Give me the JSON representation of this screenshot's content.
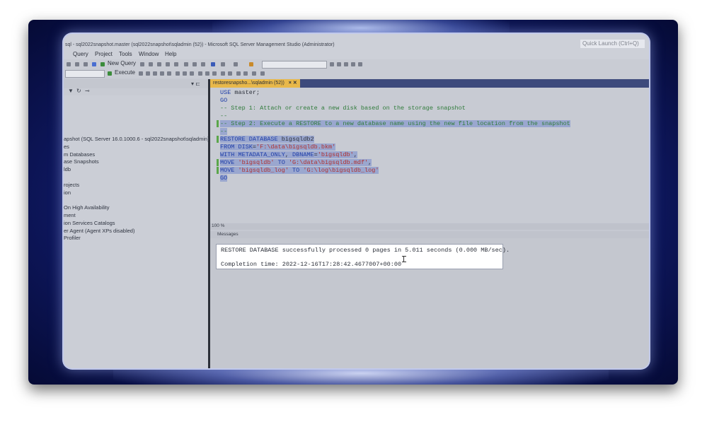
{
  "window": {
    "title": "sql - sql2022snapshot.master (sql2022snapshot\\sqladmin (52)) - Microsoft SQL Server Management Studio (Administrator)",
    "quick_launch": "Quick Launch (Ctrl+Q)"
  },
  "menu": [
    "Query",
    "Project",
    "Tools",
    "Window",
    "Help"
  ],
  "toolbar": {
    "new_query": "New Query",
    "execute": "Execute"
  },
  "object_explorer": {
    "items": [
      "apshot (SQL Server 16.0.1000.6 - sql2022snapshot\\sqladmin)",
      "es",
      "m Databases",
      "ase Snapshots",
      "ldb",
      "",
      "rojects",
      "ion",
      "",
      "On High Availability",
      "ment",
      "ion Services Catalogs",
      "er Agent (Agent XPs disabled)",
      "Profiler"
    ]
  },
  "editor": {
    "tab_label": "restoresnapsho...\\sqladmin (52))",
    "lines": [
      {
        "tokens": [
          {
            "t": "USE ",
            "c": "kw"
          },
          {
            "t": "master",
            "c": "pl"
          },
          {
            "t": ";",
            "c": "pl"
          }
        ],
        "sel": false
      },
      {
        "tokens": [
          {
            "t": "GO",
            "c": "kw"
          }
        ],
        "sel": false
      },
      {
        "tokens": [
          {
            "t": "-- Step 1: Attach or create a new disk based on the storage snapshot",
            "c": "cm"
          }
        ],
        "sel": false
      },
      {
        "tokens": [
          {
            "t": "--",
            "c": "cm"
          }
        ],
        "sel": false
      },
      {
        "tokens": [
          {
            "t": "-- Step 2: Execute a RESTORE to a new database name using the new file location from the snapshot",
            "c": "cm"
          }
        ],
        "sel": true
      },
      {
        "tokens": [
          {
            "t": "--",
            "c": "cm"
          }
        ],
        "sel": true
      },
      {
        "tokens": [
          {
            "t": "RESTORE DATABASE ",
            "c": "kw"
          },
          {
            "t": "bigsqldb2",
            "c": "pl"
          }
        ],
        "sel": true
      },
      {
        "tokens": [
          {
            "t": "FROM DISK",
            "c": "kw"
          },
          {
            "t": "=",
            "c": "pl"
          },
          {
            "t": "'F:\\data\\bigsqldb.bkm'",
            "c": "str"
          }
        ],
        "sel": true
      },
      {
        "tokens": [
          {
            "t": "WITH METADATA_ONLY",
            "c": "kw"
          },
          {
            "t": ", ",
            "c": "pl"
          },
          {
            "t": "DBNAME",
            "c": "kw"
          },
          {
            "t": "=",
            "c": "pl"
          },
          {
            "t": "'bigsqldb'",
            "c": "str"
          },
          {
            "t": ",",
            "c": "pl"
          }
        ],
        "sel": true
      },
      {
        "tokens": [
          {
            "t": "MOVE ",
            "c": "kw"
          },
          {
            "t": "'bigsqldb'",
            "c": "str"
          },
          {
            "t": " TO ",
            "c": "kw"
          },
          {
            "t": "'G:\\data\\bigsqldb.mdf'",
            "c": "str"
          },
          {
            "t": ",",
            "c": "pl"
          }
        ],
        "sel": true
      },
      {
        "tokens": [
          {
            "t": "MOVE ",
            "c": "kw"
          },
          {
            "t": "'bigsqldb_log'",
            "c": "str"
          },
          {
            "t": " TO ",
            "c": "kw"
          },
          {
            "t": "'G:\\log\\bigsqldb_log'",
            "c": "str"
          }
        ],
        "sel": true
      },
      {
        "tokens": [
          {
            "t": "GO",
            "c": "kw"
          }
        ],
        "sel": true
      }
    ],
    "zoom": "100 %"
  },
  "results": {
    "tab_label": "Messages",
    "message_line1": "RESTORE DATABASE successfully processed 0 pages in 5.011 seconds (0.000 MB/sec).",
    "message_line2": "Completion time: 2022-12-16T17:28:42.4677007+00:00"
  },
  "colors": {
    "keyword": "#1f3ea8",
    "string": "#b1302f",
    "comment": "#2f7b3a",
    "active_tab": "#e8b84a",
    "frame": "#101a66"
  }
}
